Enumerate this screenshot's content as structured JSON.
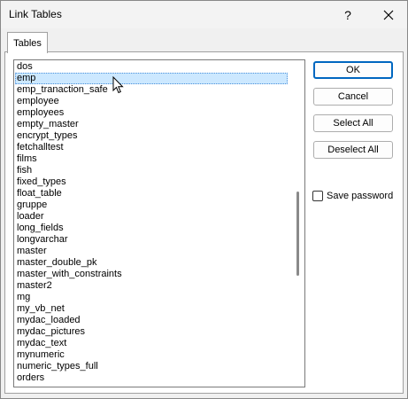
{
  "window": {
    "title": "Link Tables"
  },
  "titlebar": {
    "help_icon": "question-mark-icon",
    "close_icon": "close-icon"
  },
  "tabs": [
    {
      "label": "Tables"
    }
  ],
  "tables": {
    "items": [
      "dos",
      "emp",
      "emp_tranaction_safe",
      "employee",
      "employees",
      "empty_master",
      "encrypt_types",
      "fetchalltest",
      "films",
      "fish",
      "fixed_types",
      "float_table",
      "gruppe",
      "loader",
      "long_fields",
      "longvarchar",
      "master",
      "master_double_pk",
      "master_with_constraints",
      "master2",
      "mg",
      "my_vb_net",
      "mydac_loaded",
      "mydac_pictures",
      "mydac_text",
      "mynumeric",
      "numeric_types_full",
      "orders"
    ],
    "selected_index": 1
  },
  "buttons": {
    "ok": "OK",
    "cancel": "Cancel",
    "select_all": "Select All",
    "deselect_all": "Deselect All"
  },
  "save_password": {
    "label": "Save password",
    "checked": false
  }
}
